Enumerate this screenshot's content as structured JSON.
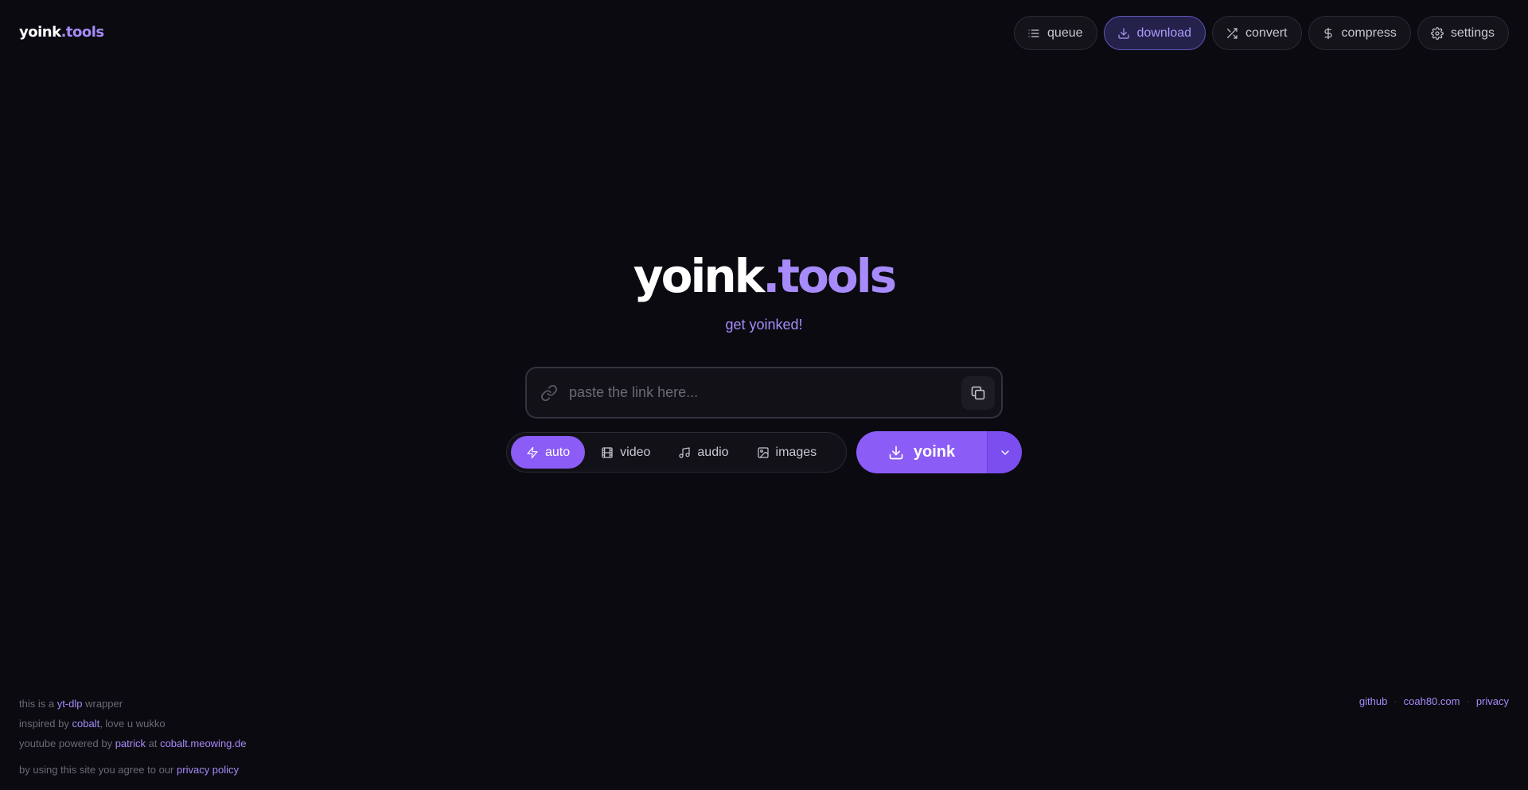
{
  "header": {
    "logo_main": "yoink",
    "logo_accent": ".tools",
    "nav": [
      {
        "label": "queue",
        "icon": "list-icon"
      },
      {
        "label": "download",
        "icon": "download-icon",
        "active": true
      },
      {
        "label": "convert",
        "icon": "shuffle-icon"
      },
      {
        "label": "compress",
        "icon": "dollar-icon"
      },
      {
        "label": "settings",
        "icon": "gear-icon"
      }
    ]
  },
  "hero": {
    "title_main": "yoink",
    "title_accent": ".tools",
    "tagline": "get yoinked!"
  },
  "search": {
    "placeholder": "paste the link here...",
    "value": ""
  },
  "modes": [
    {
      "label": "auto",
      "icon": "bolt-icon",
      "active": true
    },
    {
      "label": "video",
      "icon": "film-icon"
    },
    {
      "label": "audio",
      "icon": "music-icon"
    },
    {
      "label": "images",
      "icon": "image-icon"
    }
  ],
  "action": {
    "yoink_label": "yoink"
  },
  "footer": {
    "line1_pre": "this is a ",
    "line1_link": "yt-dlp",
    "line1_post": " wrapper",
    "line2_pre": "inspired by ",
    "line2_link": "cobalt",
    "line2_post": ", love u wukko",
    "line3_pre": "youtube powered by ",
    "line3_link1": "patrick",
    "line3_mid": " at ",
    "line3_link2": "cobalt.meowing.de",
    "line4_pre": "by using this site you agree to our ",
    "line4_link": "privacy policy",
    "right_links": [
      "github",
      "coah80.com",
      "privacy"
    ],
    "separator": "·"
  },
  "colors": {
    "accent": "#a78bfa",
    "button": "#8b5cf6",
    "background": "#0b0a10"
  }
}
